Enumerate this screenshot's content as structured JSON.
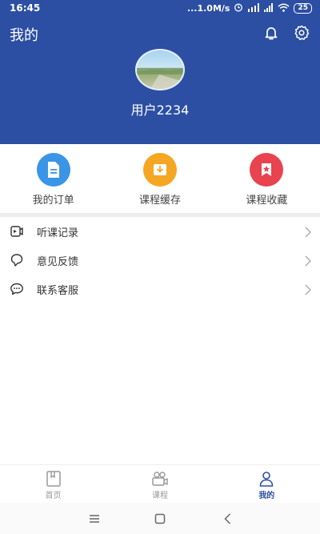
{
  "status_bar": {
    "time": "16:45",
    "network_speed": "...1.0M/s",
    "battery": "25"
  },
  "header": {
    "title": "我的",
    "username": "用户2234"
  },
  "quick_actions": [
    {
      "label": "我的订单",
      "icon": "order-icon",
      "color": "#3a95e6"
    },
    {
      "label": "课程缓存",
      "icon": "download-icon",
      "color": "#f5a623"
    },
    {
      "label": "课程收藏",
      "icon": "star-bookmark-icon",
      "color": "#e8434f"
    }
  ],
  "menu": [
    {
      "label": "听课记录",
      "icon": "history-icon"
    },
    {
      "label": "意见反馈",
      "icon": "feedback-icon"
    },
    {
      "label": "联系客服",
      "icon": "chat-icon"
    }
  ],
  "tabs": [
    {
      "label": "首页",
      "icon": "home-book-icon",
      "active": false
    },
    {
      "label": "课程",
      "icon": "course-camera-icon",
      "active": false
    },
    {
      "label": "我的",
      "icon": "profile-icon",
      "active": true
    }
  ],
  "colors": {
    "primary": "#2c4fa3",
    "divider": "#eeeeee"
  }
}
